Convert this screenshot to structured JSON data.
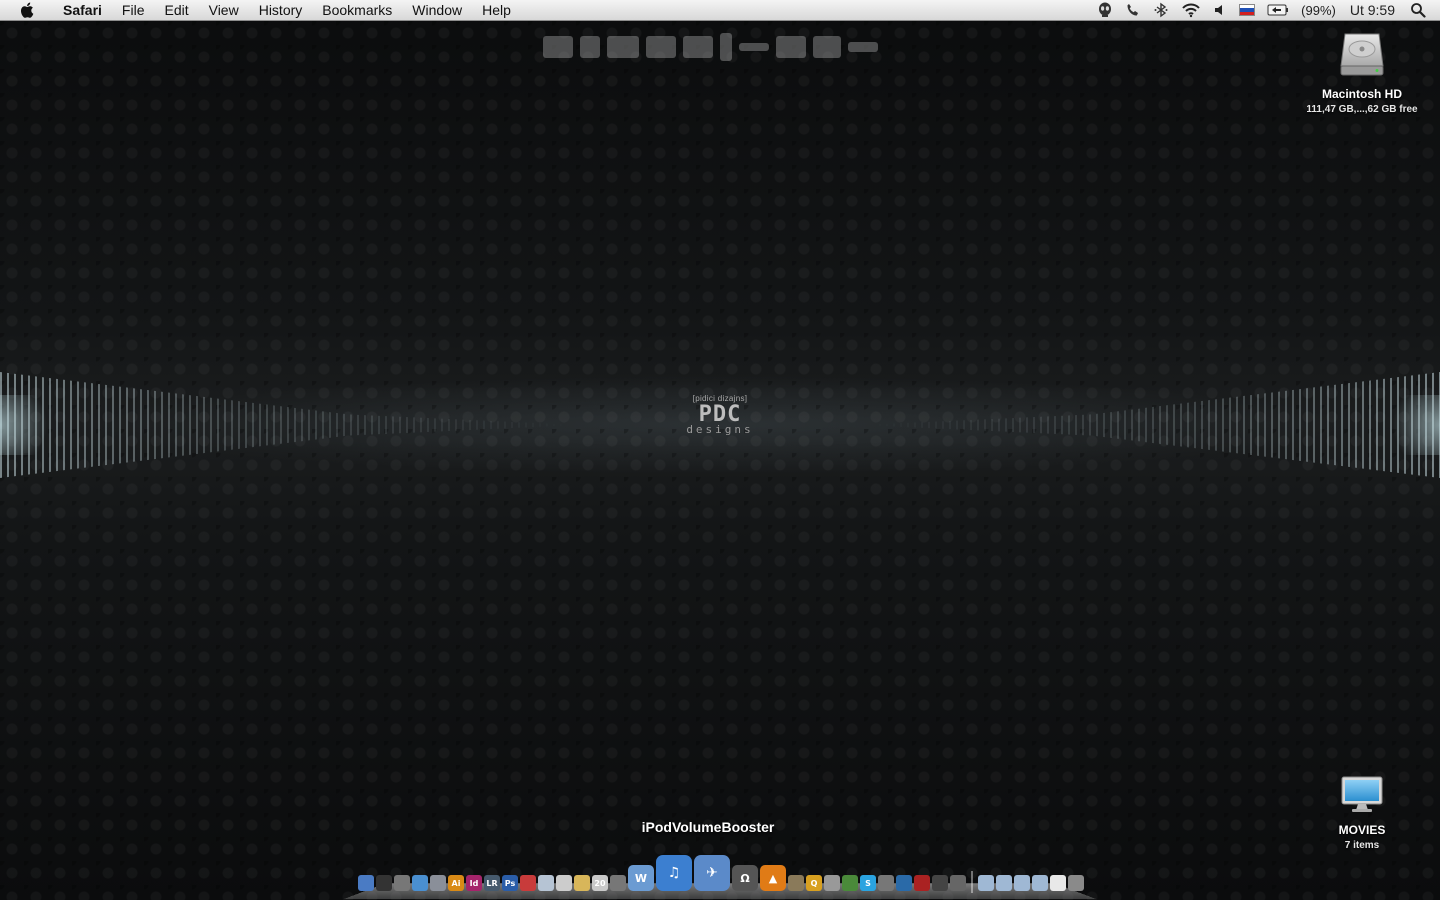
{
  "menubar": {
    "apple_icon": "apple-icon",
    "app_name": "Safari",
    "menus": [
      "File",
      "Edit",
      "View",
      "History",
      "Bookmarks",
      "Window",
      "Help"
    ],
    "status": {
      "alien_icon": "alien-icon",
      "phone_icon": "phone-icon",
      "bluetooth_icon": "bluetooth-icon",
      "wifi_icon": "wifi-icon",
      "volume_icon": "volume-icon",
      "flag_icon": "slovenian-flag-icon",
      "battery_icon": "battery-icon",
      "battery_text": "(99%)",
      "clock": "Ut 9:59",
      "spotlight_icon": "spotlight-icon"
    }
  },
  "desktop": {
    "items": [
      {
        "name": "Macintosh HD",
        "info": "111,47 GB,...,62 GB free",
        "icon": "hard-drive-icon"
      },
      {
        "name": "MOVIES",
        "info": "7 items",
        "icon": "monitor-folder-icon"
      }
    ]
  },
  "wallpaper": {
    "logo_tag": "[pidici dizajns]",
    "logo_mark": "PDC",
    "logo_sub": "designs"
  },
  "dock": {
    "hover_label": "iPodVolumeBooster",
    "items": [
      {
        "name": "finder",
        "glyph": "",
        "color": "#4a7bc4"
      },
      {
        "name": "dashboard",
        "glyph": "",
        "color": "#333"
      },
      {
        "name": "system-prefs",
        "glyph": "",
        "color": "#777"
      },
      {
        "name": "safari",
        "glyph": "",
        "color": "#4a8fd0"
      },
      {
        "name": "mail",
        "glyph": "",
        "color": "#8a8f99"
      },
      {
        "name": "illustrator",
        "glyph": "Ai",
        "color": "#d98a16"
      },
      {
        "name": "indesign",
        "glyph": "Id",
        "color": "#a5246b"
      },
      {
        "name": "lightroom",
        "glyph": "LR",
        "color": "#465a6d"
      },
      {
        "name": "photoshop",
        "glyph": "Ps",
        "color": "#2a5da8"
      },
      {
        "name": "acrobat",
        "glyph": "",
        "color": "#c83b3b"
      },
      {
        "name": "preview",
        "glyph": "",
        "color": "#b6c4d4"
      },
      {
        "name": "textedit",
        "glyph": "",
        "color": "#ccc"
      },
      {
        "name": "notes",
        "glyph": "",
        "color": "#d8b65a"
      },
      {
        "name": "ical",
        "glyph": "20",
        "color": "#c9c9c9"
      },
      {
        "name": "script-editor",
        "glyph": "",
        "color": "#777"
      },
      {
        "name": "word",
        "glyph": "W",
        "color": "#6b9bd2",
        "size": "mid"
      },
      {
        "name": "itunes",
        "glyph": "♫",
        "color": "#3c7fd0",
        "size": "big"
      },
      {
        "name": "ipod-volume-booster",
        "glyph": "✈",
        "color": "#5b8ac9",
        "size": "big"
      },
      {
        "name": "dvd-player",
        "glyph": "Ω",
        "color": "#555",
        "size": "mid"
      },
      {
        "name": "vlc",
        "glyph": "▲",
        "color": "#e07b16",
        "size": "mid"
      },
      {
        "name": "iphoto",
        "glyph": "",
        "color": "#8a7a5a"
      },
      {
        "name": "spotlight-app",
        "glyph": "Q",
        "color": "#d8a020"
      },
      {
        "name": "script",
        "glyph": "",
        "color": "#999"
      },
      {
        "name": "utorrent",
        "glyph": "",
        "color": "#4a8a3a"
      },
      {
        "name": "skype",
        "glyph": "S",
        "color": "#2aa3e0"
      },
      {
        "name": "automator",
        "glyph": "",
        "color": "#777"
      },
      {
        "name": "time-machine",
        "glyph": "",
        "color": "#2a6aa8"
      },
      {
        "name": "photo-booth",
        "glyph": "",
        "color": "#aa2222"
      },
      {
        "name": "calculator",
        "glyph": "",
        "color": "#444"
      },
      {
        "name": "activity-monitor",
        "glyph": "",
        "color": "#666"
      },
      {
        "name": "folder-1",
        "glyph": "",
        "color": "#9fb8d4",
        "sep": true
      },
      {
        "name": "folder-2",
        "glyph": "",
        "color": "#9fb8d4"
      },
      {
        "name": "folder-3",
        "glyph": "",
        "color": "#9fb8d4"
      },
      {
        "name": "folder-4",
        "glyph": "",
        "color": "#9fb8d4"
      },
      {
        "name": "document",
        "glyph": "",
        "color": "#e8e8e8"
      },
      {
        "name": "trash",
        "glyph": "",
        "color": "#8a8a8a"
      }
    ]
  }
}
